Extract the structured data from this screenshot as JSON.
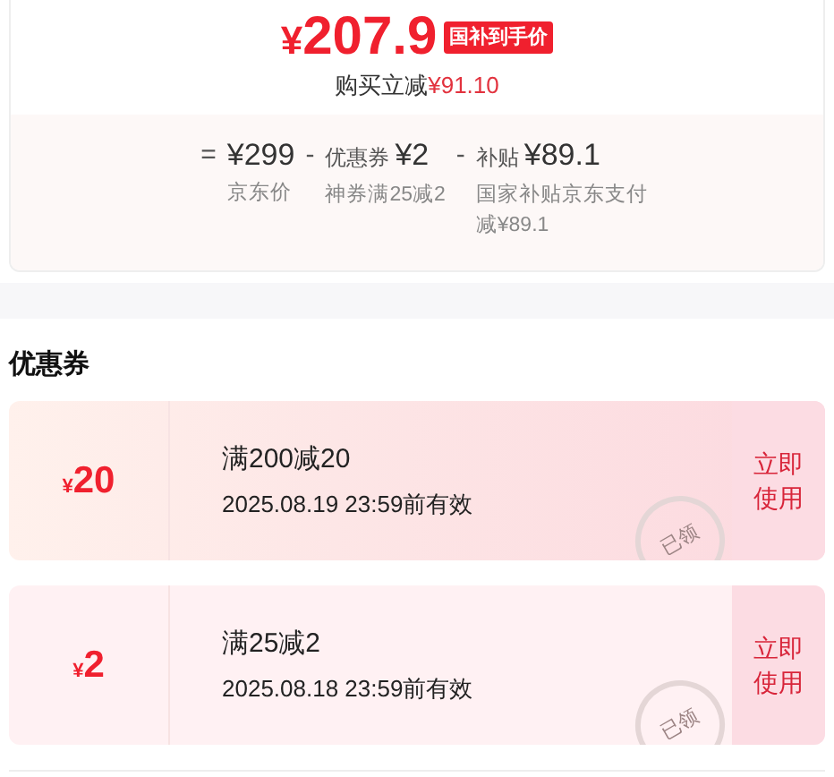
{
  "price": {
    "currency": "¥",
    "amount": "207.9",
    "badge": "国补到手价"
  },
  "savings": {
    "label": "购买立减",
    "amount": "¥91.10"
  },
  "breakdown": [
    {
      "operator": "=",
      "amount": "¥299",
      "note": "京东价"
    },
    {
      "operator": "-",
      "prefix": "优惠券",
      "amount": "¥2",
      "note": "神券满25减2"
    },
    {
      "operator": "-",
      "prefix": "补贴",
      "amount": "¥89.1",
      "note": "国家补贴京东支付减¥89.1"
    }
  ],
  "coupons_title": "优惠券",
  "coupons": [
    {
      "kind": "gradient",
      "currency": "¥",
      "value": "20",
      "condition": "满200减20",
      "validity": "2025.08.19 23:59前有效",
      "stamp": "已领",
      "action": "立即使用"
    },
    {
      "kind": "plain",
      "currency": "¥",
      "value": "2",
      "condition": "满25减2",
      "validity": "2025.08.18 23:59前有效",
      "stamp": "已领",
      "action": "立即使用"
    }
  ]
}
